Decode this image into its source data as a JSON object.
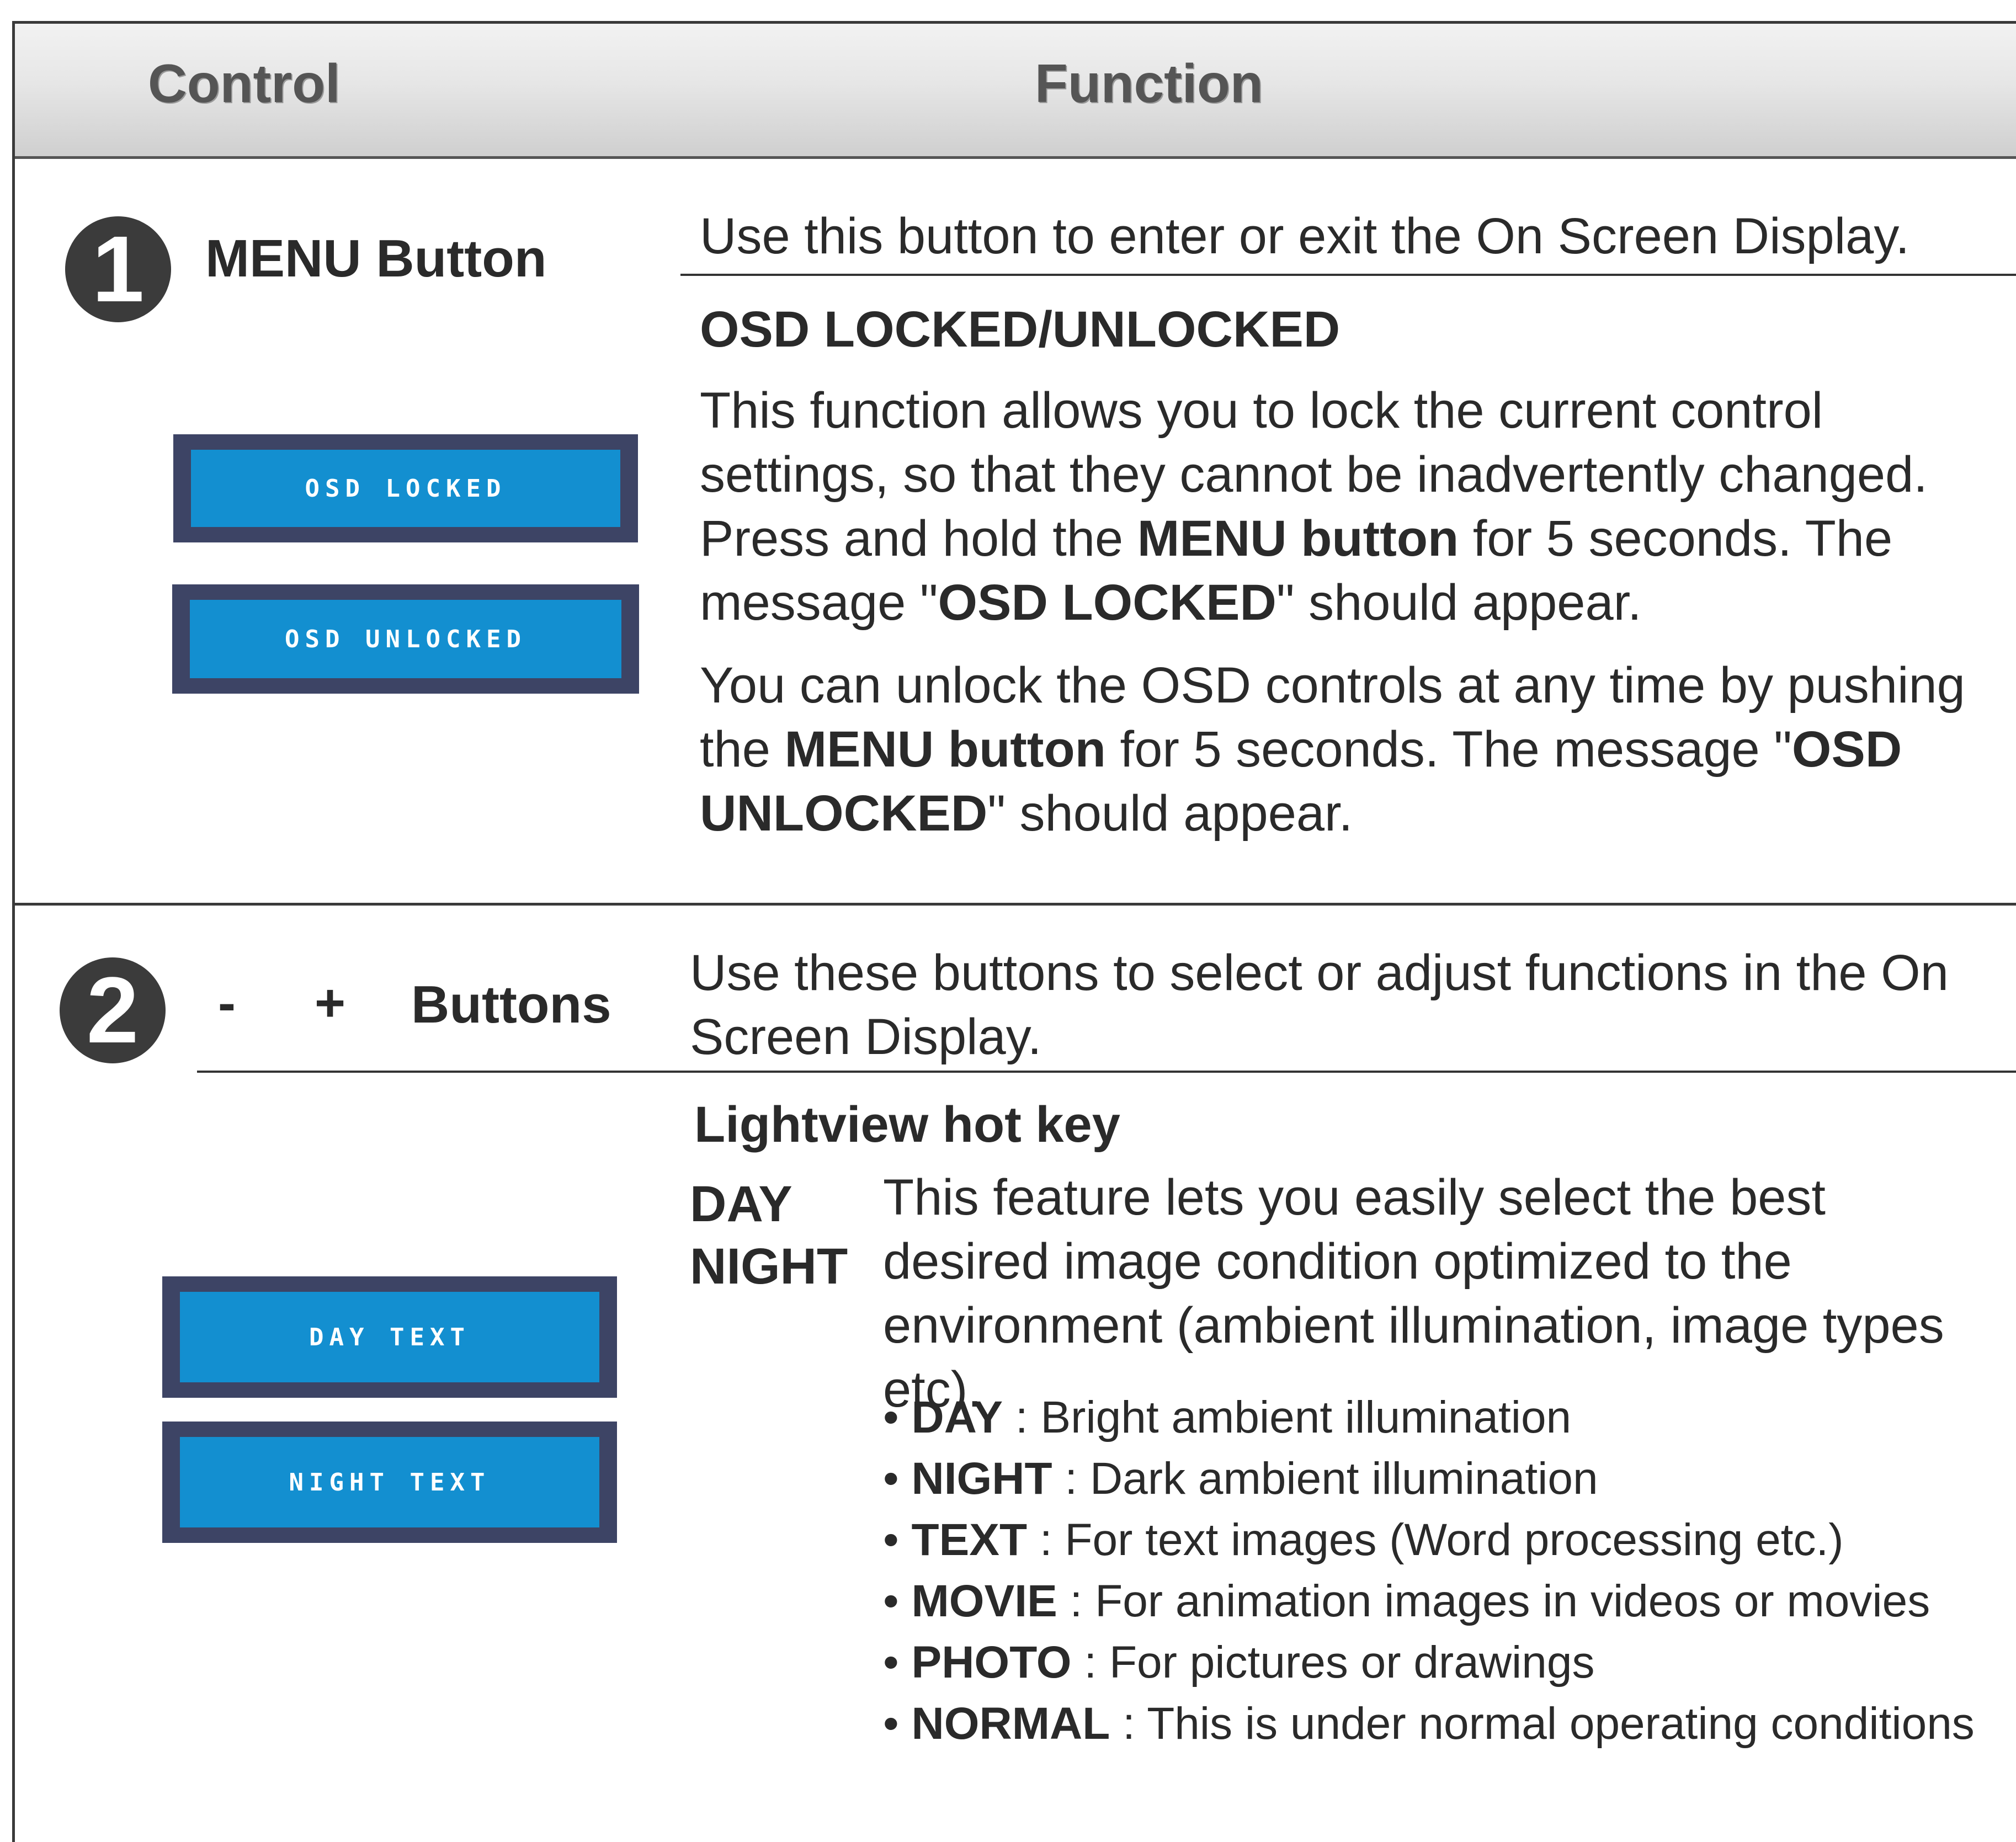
{
  "header": {
    "control": "Control",
    "function": "Function"
  },
  "row1": {
    "number": "1",
    "control_label": "MENU Button",
    "intro": "Use this button to enter or exit the On Screen Display.",
    "subheading": "OSD LOCKED/UNLOCKED",
    "para1": {
      "t1": "This function allows you to lock the current control settings, so that they cannot be inadvertently changed. Press and hold the ",
      "b1": "MENU button",
      "t2": " for 5 seconds. The message \"",
      "b2": "OSD LOCKED",
      "t3": "\" should appear."
    },
    "para2": {
      "t1": "You can unlock the OSD controls at any time by pushing the ",
      "b1": "MENU button",
      "t2": " for 5 seconds. The message \"",
      "b2": "OSD UNLOCKED",
      "t3": "\" should appear."
    },
    "osd_locked": "OSD LOCKED",
    "osd_unlocked": "OSD UNLOCKED"
  },
  "row2": {
    "number": "2",
    "minus": "-",
    "plus": "+",
    "control_label": "Buttons",
    "intro": "Use these buttons to select or adjust functions in the On Screen Display.",
    "subheading": "Lightview hot key",
    "mode_day": "DAY",
    "mode_night": "NIGHT",
    "description": "This feature lets you easily select the best desired image condition optimized to the environment (ambient illumination, image types etc).",
    "bullets": [
      {
        "key": "DAY",
        "text": " : Bright ambient illumination"
      },
      {
        "key": "NIGHT",
        "text": " : Dark ambient illumination"
      },
      {
        "key": "TEXT",
        "text": " : For text images (Word processing etc.)"
      },
      {
        "key": "MOVIE",
        "text": " : For animation images in videos or movies"
      },
      {
        "key": "PHOTO",
        "text": " : For pictures or drawings"
      },
      {
        "key": "NORMAL",
        "text": " : This is under normal operating conditions"
      }
    ],
    "osd_day": "DAY TEXT",
    "osd_night": "NIGHT TEXT"
  }
}
